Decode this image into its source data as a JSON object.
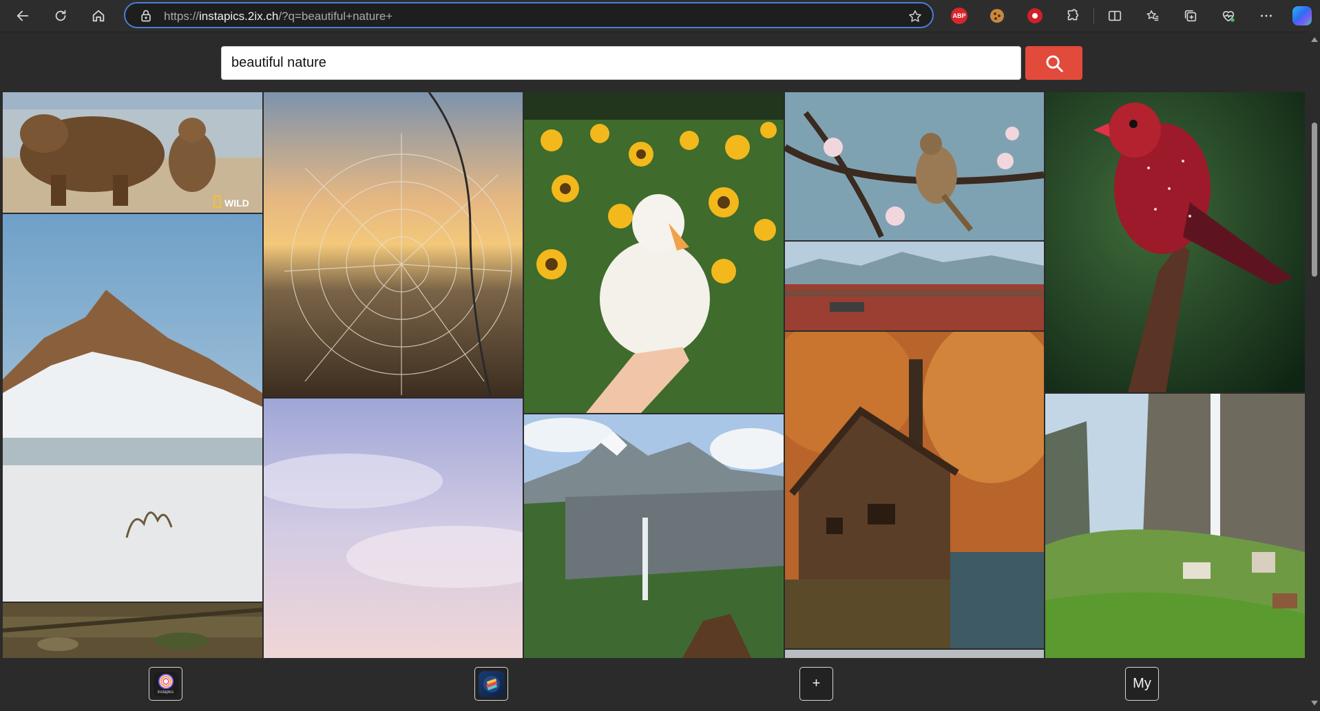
{
  "browser": {
    "url_scheme": "https://",
    "url_host": "instapics.2ix.ch",
    "url_path": "/?q=beautiful+nature+",
    "extensions": {
      "abp_label": "ABP"
    }
  },
  "search": {
    "query": "beautiful nature"
  },
  "gallery": {
    "tiles": [
      {
        "subject": "brown bear with cub on beach",
        "badge": "WILD"
      },
      {
        "subject": "snowy mountain rock with frozen lake"
      },
      {
        "subject": "forest floor leaves"
      },
      {
        "subject": "dew covered spider web at sunset"
      },
      {
        "subject": "pastel cloudy sky"
      },
      {
        "subject": "white duck in sunflower field"
      },
      {
        "subject": "alpine mountain waterfall"
      },
      {
        "subject": "sparrow on cherry blossom branch"
      },
      {
        "subject": "red plain with mountains"
      },
      {
        "subject": "wooden mill house in autumn forest"
      },
      {
        "subject": "red strawberry finch on branch"
      },
      {
        "subject": "valley waterfall with village"
      }
    ]
  },
  "bottom_nav": {
    "insta_logo_text": "instapics",
    "add_label": "+",
    "my_label": "My"
  }
}
